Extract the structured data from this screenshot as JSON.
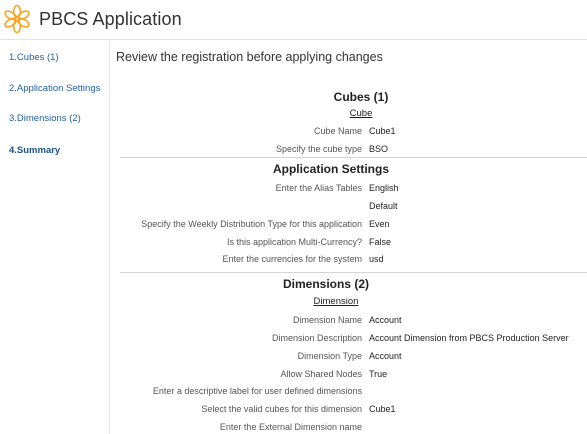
{
  "app": {
    "title": "PBCS Application"
  },
  "sidebar": {
    "items": [
      {
        "label": "1.Cubes (1)"
      },
      {
        "label": "2.Application Settings"
      },
      {
        "label": "3.Dimensions (2)"
      },
      {
        "label": "4.Summary"
      }
    ]
  },
  "main": {
    "heading": "Review the registration before applying changes",
    "cubes": {
      "title": "Cubes (1)",
      "subtitle": "Cube",
      "rows": [
        {
          "label": "Cube Name",
          "value": "Cube1"
        },
        {
          "label": "Specify the cube type",
          "value": "BSO"
        }
      ]
    },
    "app_settings": {
      "title": "Application Settings",
      "rows": [
        {
          "label": "Enter the Alias Tables",
          "value": "English"
        },
        {
          "label": "",
          "value": "Default"
        },
        {
          "label": "Specify the Weekly Distribution Type for this application",
          "value": "Even"
        },
        {
          "label": "Is this application Multi-Currency?",
          "value": "False"
        },
        {
          "label": "Enter the currencies for the system",
          "value": "usd"
        }
      ]
    },
    "dimensions": {
      "title": "Dimensions (2)",
      "subtitle": "Dimension",
      "rows": [
        {
          "label": "Dimension Name",
          "value": "Account"
        },
        {
          "label": "Dimension Description",
          "value": "Account Dimension from PBCS Production Server"
        },
        {
          "label": "Dimension Type",
          "value": "Account"
        },
        {
          "label": "Allow Shared Nodes",
          "value": "True"
        },
        {
          "label": "Enter a descriptive label for user defined dimensions",
          "value": ""
        },
        {
          "label": "Select the valid cubes for this dimension",
          "value": "Cube1"
        },
        {
          "label": "Enter the External Dimension name",
          "value": ""
        }
      ]
    }
  }
}
